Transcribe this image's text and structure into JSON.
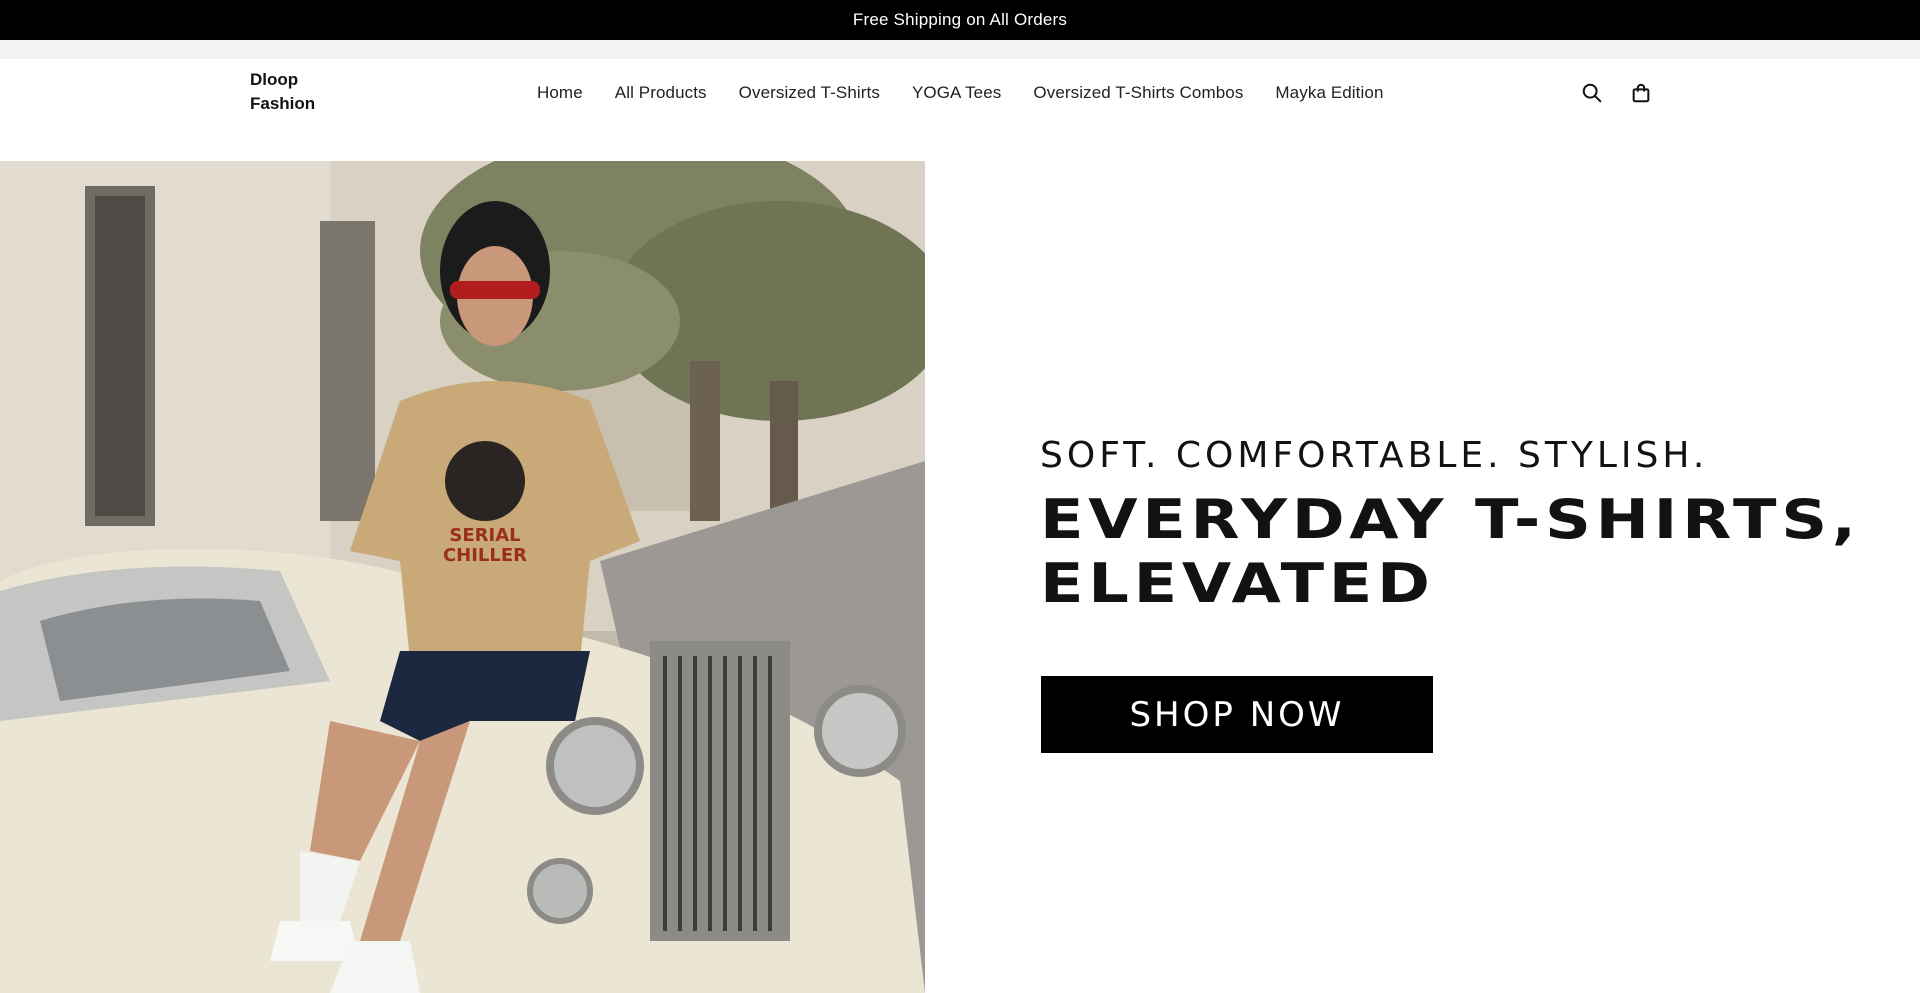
{
  "announcement": {
    "text": "Free Shipping on All Orders"
  },
  "header": {
    "logo_line1": "Dloop",
    "logo_line2": "Fashion",
    "nav": [
      {
        "label": "Home"
      },
      {
        "label": "All Products"
      },
      {
        "label": "Oversized T-Shirts"
      },
      {
        "label": "YOGA Tees"
      },
      {
        "label": "Oversized T-Shirts Combos"
      },
      {
        "label": "Mayka Edition"
      }
    ],
    "icons": {
      "search": "search-icon",
      "cart": "shopping-bag-icon"
    }
  },
  "hero": {
    "image_icon": "model-with-vintage-car-photo",
    "subtitle": "SOFT. COMFORTABLE. STYLISH.",
    "title_line1": "EVERYDAY T-SHIRTS,",
    "title_line2": "ELEVATED",
    "button_label": "SHOP NOW"
  },
  "colors": {
    "announcement_bg": "#000000",
    "text": "#121212",
    "button_bg": "#000000",
    "button_text": "#ffffff"
  }
}
